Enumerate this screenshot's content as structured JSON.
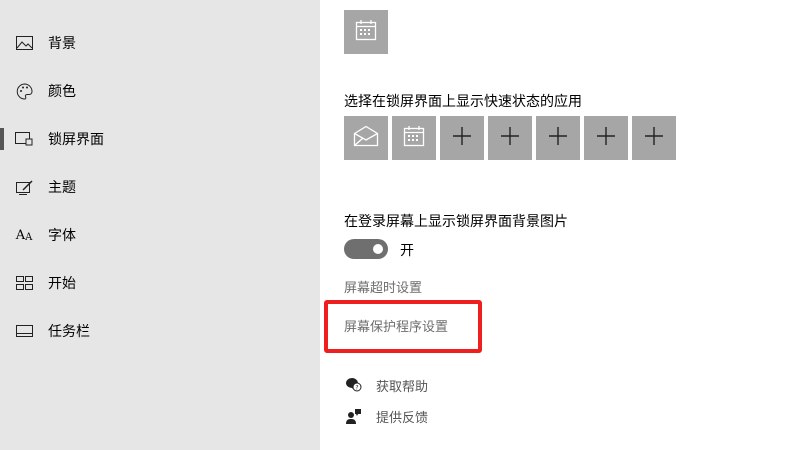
{
  "sidebar": {
    "items": [
      {
        "label": "背景",
        "icon": "picture-icon"
      },
      {
        "label": "颜色",
        "icon": "palette-icon"
      },
      {
        "label": "锁屏界面",
        "icon": "lock-screen-icon"
      },
      {
        "label": "主题",
        "icon": "theme-brush-icon"
      },
      {
        "label": "字体",
        "icon": "font-icon"
      },
      {
        "label": "开始",
        "icon": "start-grid-icon"
      },
      {
        "label": "任务栏",
        "icon": "taskbar-icon"
      }
    ],
    "active_index": 2
  },
  "lockscreen": {
    "detailed_status_app_icon": "calendar-icon",
    "quick_status_label": "选择在锁屏界面上显示快速状态的应用",
    "quick_status_apps": [
      {
        "icon": "mail-icon"
      },
      {
        "icon": "calendar-icon"
      },
      {
        "icon": "plus-icon"
      },
      {
        "icon": "plus-icon"
      },
      {
        "icon": "plus-icon"
      },
      {
        "icon": "plus-icon"
      },
      {
        "icon": "plus-icon"
      }
    ],
    "signin_background_label": "在登录屏幕上显示锁屏界面背景图片",
    "signin_background_toggle": {
      "state_label": "开",
      "on": true
    },
    "timeout_link": "屏幕超时设置",
    "screensaver_link": "屏幕保护程序设置"
  },
  "help": {
    "get_help": "获取帮助",
    "give_feedback": "提供反馈"
  },
  "colors": {
    "sidebar_bg": "#e6e6e6",
    "tile_bg": "#a6a6a6",
    "toggle_on": "#6f6f6f",
    "highlight": "#ef1f1f"
  }
}
